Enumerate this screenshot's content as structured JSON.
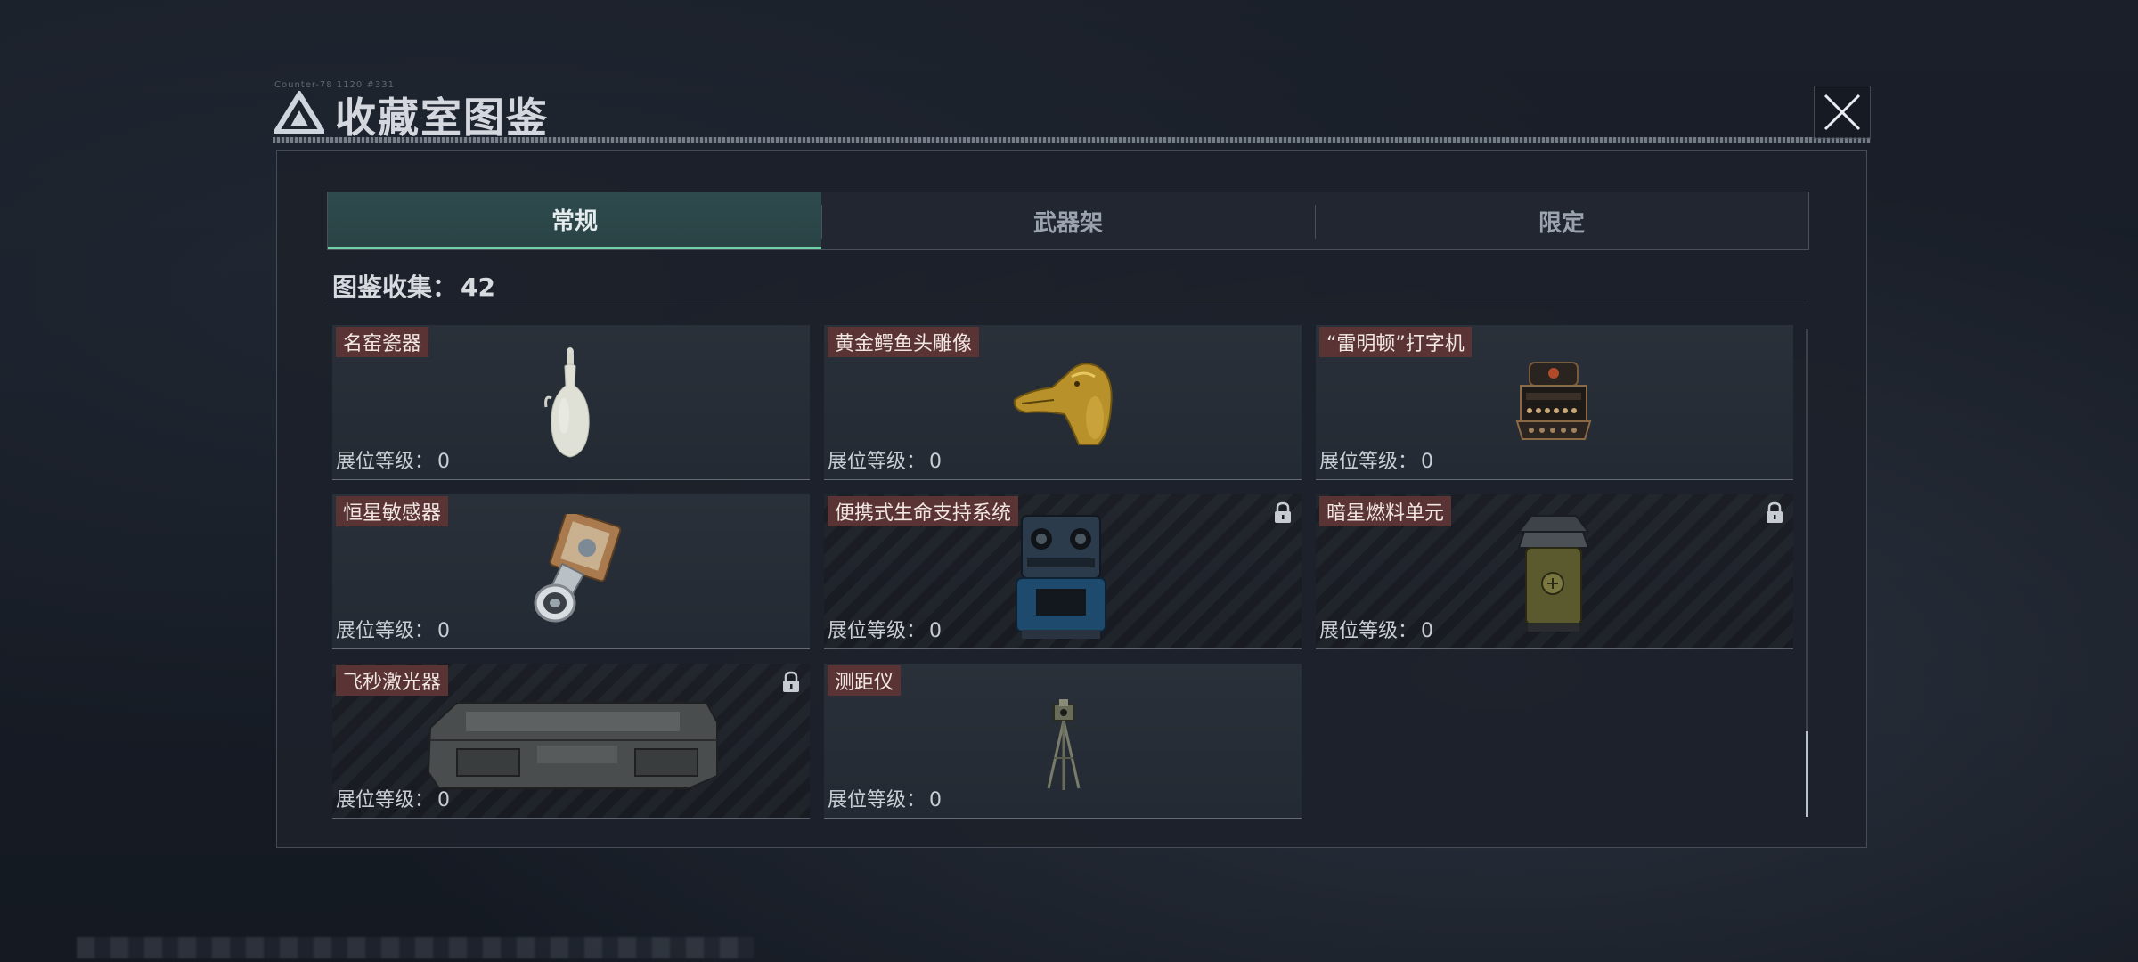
{
  "header": {
    "tiny_text": "Counter-78 1120 #331",
    "title": "收藏室图鉴",
    "close_label": "close"
  },
  "tabs": [
    {
      "label": "常规",
      "active": true
    },
    {
      "label": "武器架",
      "active": false
    },
    {
      "label": "限定",
      "active": false
    }
  ],
  "collection": {
    "label": "图鉴收集：",
    "count": "42"
  },
  "items": [
    {
      "name": "名窑瓷器",
      "level_label": "展位等级：",
      "level": "0",
      "locked": false,
      "icon": "porcelain-vase-icon"
    },
    {
      "name": "黄金鳄鱼头雕像",
      "level_label": "展位等级：",
      "level": "0",
      "locked": false,
      "icon": "golden-crocodile-head-icon"
    },
    {
      "name": "“雷明顿”打字机",
      "level_label": "展位等级：",
      "level": "0",
      "locked": false,
      "icon": "typewriter-icon"
    },
    {
      "name": "恒星敏感器",
      "level_label": "展位等级：",
      "level": "0",
      "locked": false,
      "icon": "star-sensor-icon"
    },
    {
      "name": "便携式生命支持系统",
      "level_label": "展位等级：",
      "level": "0",
      "locked": true,
      "icon": "life-support-icon"
    },
    {
      "name": "暗星燃料单元",
      "level_label": "展位等级：",
      "level": "0",
      "locked": true,
      "icon": "fuel-cell-icon"
    },
    {
      "name": "飞秒激光器",
      "level_label": "展位等级：",
      "level": "0",
      "locked": true,
      "icon": "femtosecond-laser-icon"
    },
    {
      "name": "测距仪",
      "level_label": "展位等级：",
      "level": "0",
      "locked": false,
      "icon": "rangefinder-icon"
    }
  ],
  "colors": {
    "accent_tab_underline": "#6fd3a7",
    "name_tag_bg": "#5a3434",
    "panel_bg": "#1c212a"
  }
}
